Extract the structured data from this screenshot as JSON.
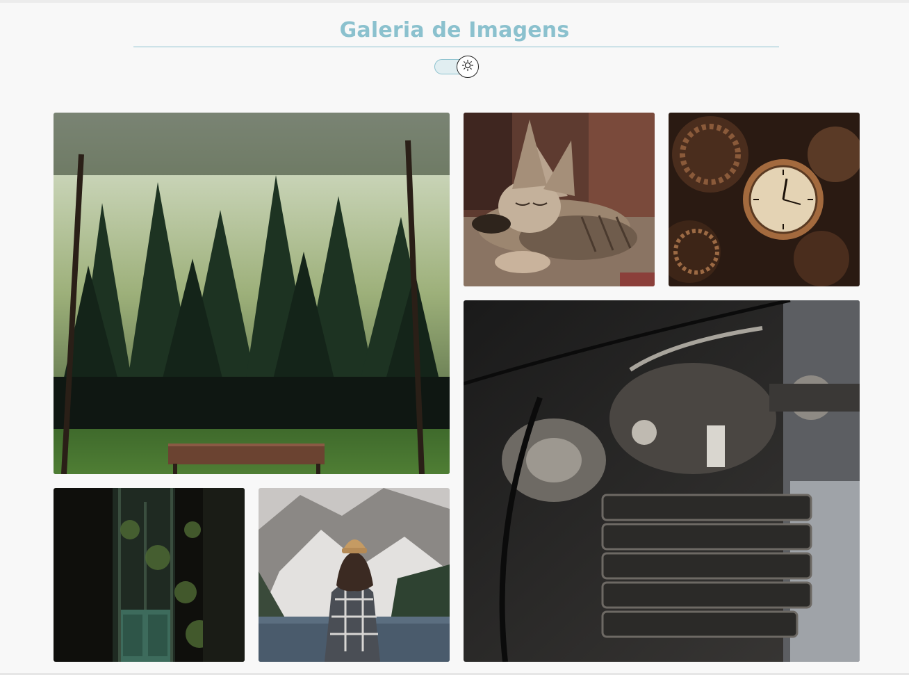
{
  "page": {
    "title": "Galeria de Imagens"
  },
  "theme_toggle": {
    "icon": "sun-icon",
    "state": "light"
  },
  "gallery": {
    "images": [
      {
        "subject": "forest-bench"
      },
      {
        "subject": "sleeping-kitten"
      },
      {
        "subject": "clockwork-gears"
      },
      {
        "subject": "motorcycle-engine"
      },
      {
        "subject": "overgrown-greenhouse-door"
      },
      {
        "subject": "woman-by-mountain-lake"
      }
    ]
  },
  "colors": {
    "accent": "#8bc1ce",
    "background": "#f8f8f8"
  }
}
